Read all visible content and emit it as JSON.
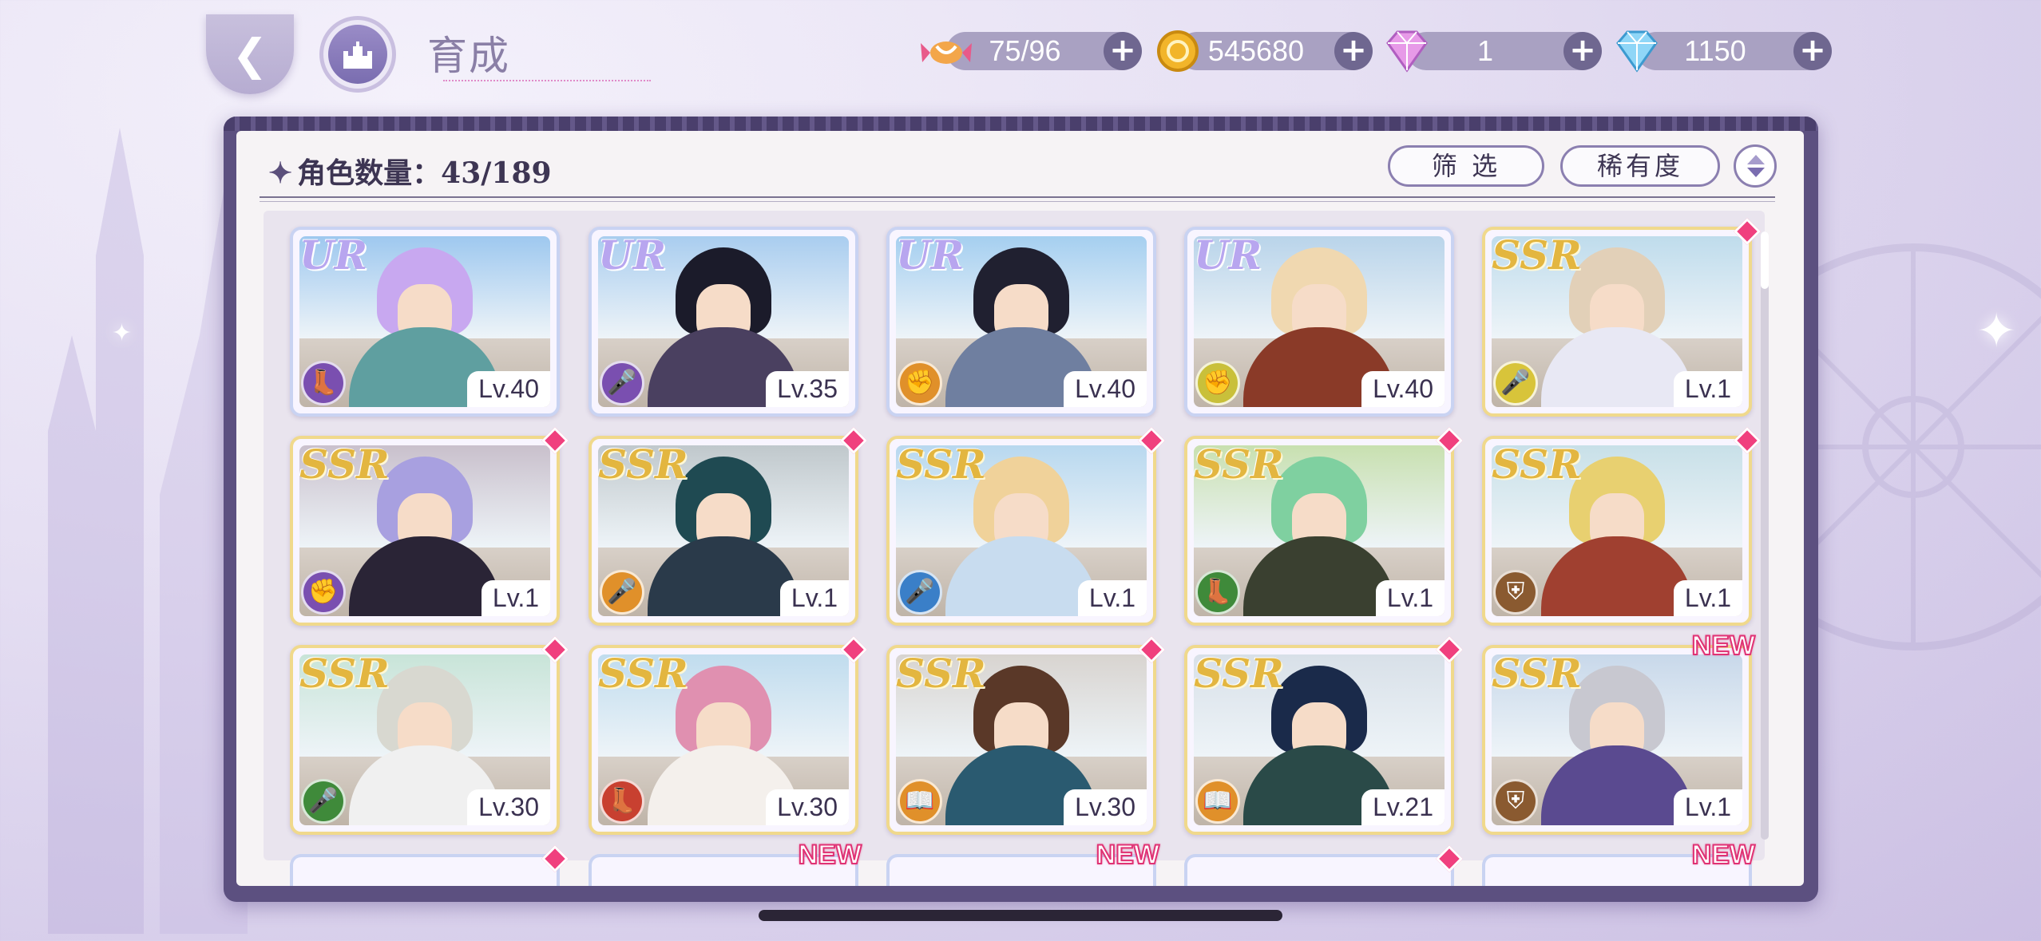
{
  "header": {
    "title": "育成",
    "resources": [
      {
        "name": "stamina",
        "icon": "candy-icon",
        "value": "75/96"
      },
      {
        "name": "gold",
        "icon": "coin-icon",
        "value": "545680"
      },
      {
        "name": "pink_gem",
        "icon": "pink-diamond-icon",
        "value": "1"
      },
      {
        "name": "blue_gem",
        "icon": "blue-diamond-icon",
        "value": "1150"
      }
    ]
  },
  "panel": {
    "count_label": "角色数量：43/189",
    "filter_label": "筛 选",
    "sort_label": "稀有度"
  },
  "colors": {
    "panel_frame": "#5c5080",
    "accent": "#8b7fb0",
    "gem_pink": "#f0407e",
    "ur": "#b8a6ef",
    "ssr": "#e3b640"
  },
  "cards": [
    {
      "rarity": "UR",
      "level": "Lv.40",
      "type_color": "#7a4fb0",
      "type_icon": "boot-icon",
      "gem": false,
      "new": false,
      "hair": "#c8a8f0",
      "outfit": "#5f9fa0",
      "sky": "#9ec8ef"
    },
    {
      "rarity": "UR",
      "level": "Lv.35",
      "type_color": "#7a4fb0",
      "type_icon": "microphone-icon",
      "gem": false,
      "new": false,
      "hair": "#1b1b2a",
      "outfit": "#4a4060",
      "sky": "#a9cdef"
    },
    {
      "rarity": "UR",
      "level": "Lv.40",
      "type_color": "#e0902a",
      "type_icon": "fist-icon",
      "gem": false,
      "new": false,
      "hair": "#202030",
      "outfit": "#6f7fa0",
      "sky": "#a5cff0"
    },
    {
      "rarity": "UR",
      "level": "Lv.40",
      "type_color": "#c9c03a",
      "type_icon": "fist-icon",
      "gem": false,
      "new": false,
      "hair": "#f0d8b0",
      "outfit": "#8a3a28",
      "sky": "#b9d4ea"
    },
    {
      "rarity": "SSR",
      "level": "Lv.1",
      "type_color": "#d8c43a",
      "type_icon": "microphone-icon",
      "gem": true,
      "new": false,
      "hair": "#e2d0b8",
      "outfit": "#e8e8f4",
      "sky": "#bfdcec"
    },
    {
      "rarity": "SSR",
      "level": "Lv.1",
      "type_color": "#7a4fb0",
      "type_icon": "fist-icon",
      "gem": true,
      "new": false,
      "hair": "#a8a0e0",
      "outfit": "#2a2436",
      "sky": "#c9c0cc"
    },
    {
      "rarity": "SSR",
      "level": "Lv.1",
      "type_color": "#e0902a",
      "type_icon": "microphone-icon",
      "gem": true,
      "new": false,
      "hair": "#1f4a52",
      "outfit": "#2a3a4a",
      "sky": "#c0c8cc"
    },
    {
      "rarity": "SSR",
      "level": "Lv.1",
      "type_color": "#3a7fc8",
      "type_icon": "microphone-icon",
      "gem": true,
      "new": false,
      "hair": "#f0d29a",
      "outfit": "#c8dcef",
      "sky": "#b8d8ef"
    },
    {
      "rarity": "SSR",
      "level": "Lv.1",
      "type_color": "#3f8a3a",
      "type_icon": "boot-icon",
      "gem": true,
      "new": false,
      "hair": "#7fd0a0",
      "outfit": "#3a4030",
      "sky": "#c8e0b0"
    },
    {
      "rarity": "SSR",
      "level": "Lv.1",
      "type_color": "#8a5a30",
      "type_icon": "shield-icon",
      "gem": true,
      "new": false,
      "hair": "#e8d070",
      "outfit": "#a04030",
      "sky": "#c8e0e8"
    },
    {
      "rarity": "SSR",
      "level": "Lv.30",
      "type_color": "#3f8a3a",
      "type_icon": "microphone-icon",
      "gem": true,
      "new": false,
      "hair": "#d8d8d0",
      "outfit": "#f0f0f0",
      "sky": "#c8e4d8"
    },
    {
      "rarity": "SSR",
      "level": "Lv.30",
      "type_color": "#c84030",
      "type_icon": "boot-icon",
      "gem": true,
      "new": false,
      "hair": "#e090b0",
      "outfit": "#f4f0ec",
      "sky": "#c0dcee"
    },
    {
      "rarity": "SSR",
      "level": "Lv.30",
      "type_color": "#e0902a",
      "type_icon": "book-icon",
      "gem": true,
      "new": false,
      "hair": "#5a3828",
      "outfit": "#2a5a70",
      "sky": "#d8d4d0"
    },
    {
      "rarity": "SSR",
      "level": "Lv.21",
      "type_color": "#e0902a",
      "type_icon": "book-icon",
      "gem": true,
      "new": false,
      "hair": "#1a2a4a",
      "outfit": "#2a4a48",
      "sky": "#d8e0e8"
    },
    {
      "rarity": "SSR",
      "level": "Lv.1",
      "type_color": "#8a5a30",
      "type_icon": "shield-icon",
      "gem": false,
      "new": true,
      "hair": "#c8c8d0",
      "outfit": "#5a4a90",
      "sky": "#c8d8ea"
    }
  ],
  "new_badge": "NEW",
  "peek_row": [
    {
      "gem": true,
      "new": false
    },
    {
      "gem": false,
      "new": true
    },
    {
      "gem": false,
      "new": true
    },
    {
      "gem": true,
      "new": false
    },
    {
      "gem": false,
      "new": true
    }
  ]
}
